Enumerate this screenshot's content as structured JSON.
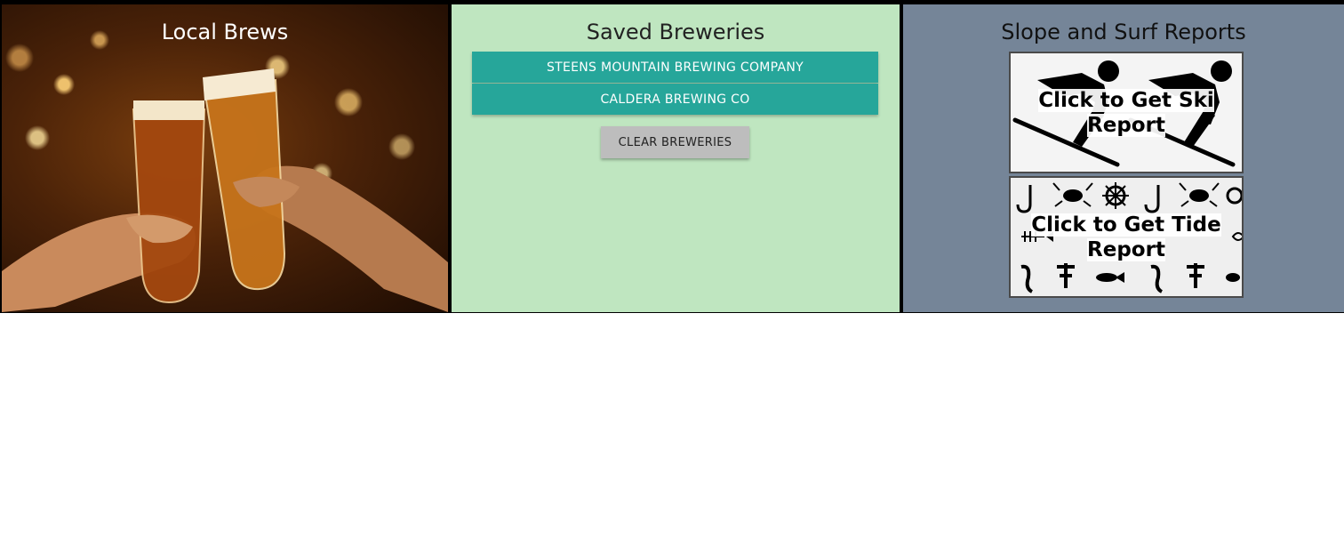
{
  "local_brews": {
    "title": "Local Brews"
  },
  "saved_breweries": {
    "title": "Saved Breweries",
    "breweries": [
      {
        "label": "STEENS MOUNTAIN BREWING COMPANY"
      },
      {
        "label": "CALDERA BREWING CO"
      }
    ],
    "clear_label": "CLEAR BREWERIES"
  },
  "reports": {
    "title": "Slope and Surf Reports",
    "ski_label": "Click to Get Ski Report",
    "tide_label": "Click to Get Tide Report"
  },
  "colors": {
    "brews_bg": "#1d0c03",
    "saved_bg": "#bfe6c0",
    "brewery_button": "#26a69a",
    "clear_button": "#bdbdbd",
    "reports_bg": "#758598"
  }
}
